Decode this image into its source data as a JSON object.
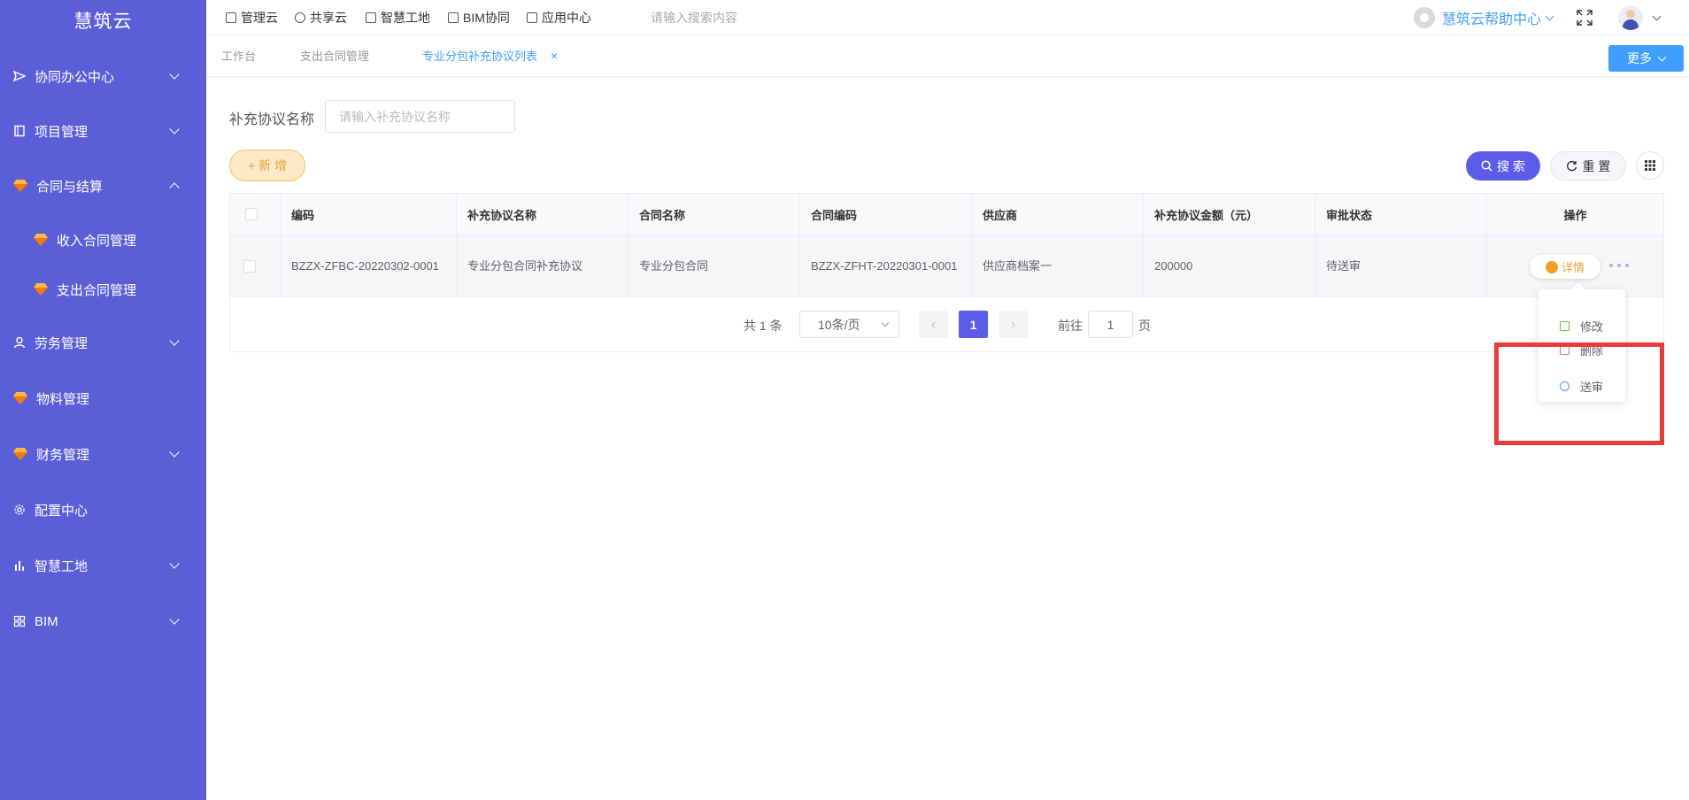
{
  "sidebar": {
    "brand": "慧筑云",
    "items": [
      {
        "label": "协同办公中心"
      },
      {
        "label": "项目管理"
      },
      {
        "label": "合同与结算"
      },
      {
        "label": "收入合同管理"
      },
      {
        "label": "支出合同管理"
      },
      {
        "label": "劳务管理"
      },
      {
        "label": "物料管理"
      },
      {
        "label": "财务管理"
      },
      {
        "label": "配置中心"
      },
      {
        "label": "智慧工地"
      },
      {
        "label": "BIM"
      }
    ]
  },
  "topbar": {
    "nav": [
      "管理云",
      "共享云",
      "智慧工地",
      "BIM协同",
      "应用中心"
    ],
    "search_placeholder": "请输入搜索内容",
    "help_label": "慧筑云帮助中心"
  },
  "tabs": {
    "items": [
      "工作台",
      "支出合同管理",
      "专业分包补充协议列表"
    ],
    "close": "×",
    "more_label": "更多"
  },
  "filter": {
    "label": "补充协议名称",
    "placeholder": "请输入补充协议名称"
  },
  "toolbar": {
    "add_label": "+ 新 增",
    "search_label": "搜 索",
    "reset_label": "重 置"
  },
  "table": {
    "columns": [
      "编码",
      "补充协议名称",
      "合同名称",
      "合同编码",
      "供应商",
      "补充协议金额（元）",
      "审批状态",
      "操作"
    ],
    "rows": [
      {
        "code": "BZZX-ZFBC-20220302-0001",
        "name": "专业分包合同补充协议",
        "contract_name": "专业分包合同",
        "contract_code": "BZZX-ZFHT-20220301-0001",
        "supplier": "供应商档案一",
        "amount": "200000",
        "status": "待送审",
        "detail_label": "详情"
      }
    ]
  },
  "pagination": {
    "total_label": "共 1 条",
    "page_size": "10条/页",
    "current_page": "1",
    "goto_prefix": "前往",
    "goto_value": "1",
    "goto_suffix": "页"
  },
  "dropdown": {
    "items": [
      "修改",
      "删除",
      "送审"
    ]
  },
  "colors": {
    "sidebar": "#5a5fd8",
    "primary": "#5b5de8",
    "accent_blue": "#409eff",
    "warning": "#e6a23c",
    "highlight": "#ea3b3b"
  }
}
